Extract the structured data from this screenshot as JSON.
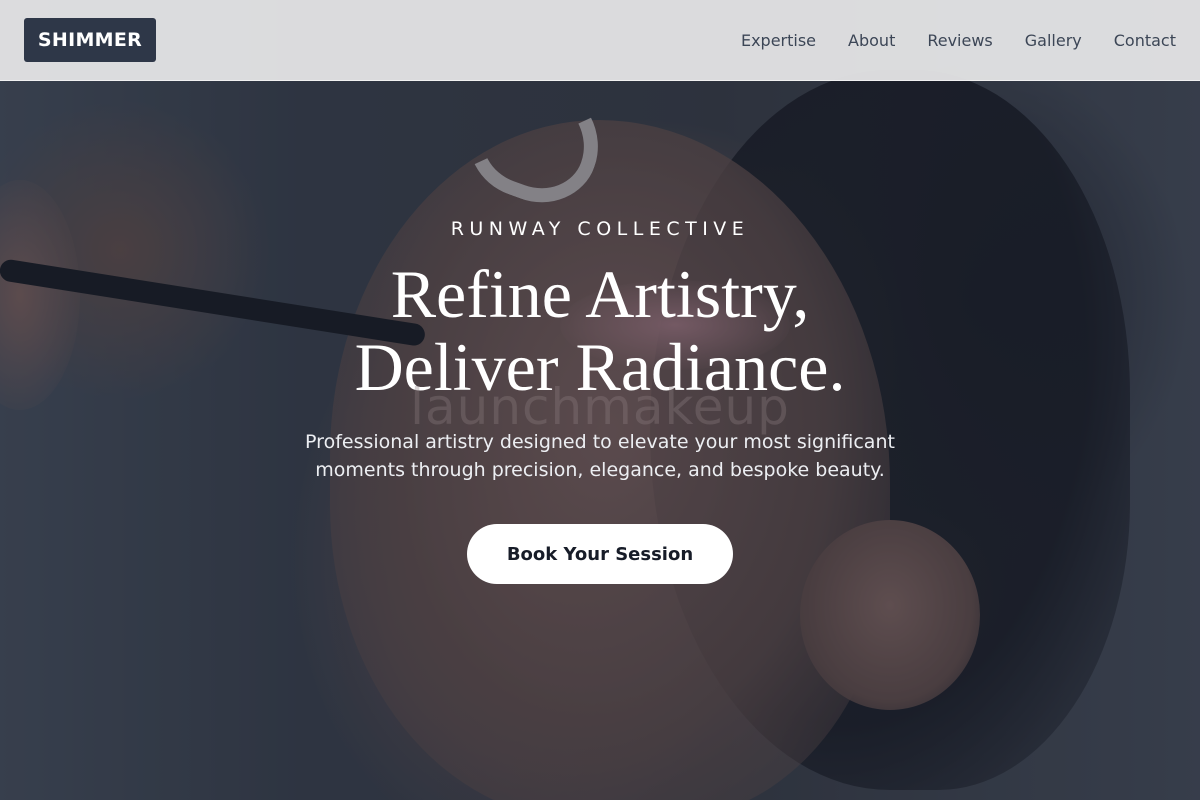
{
  "brand": {
    "logo_text": "SHIMMER",
    "logo_bg": "#2e3748"
  },
  "nav": {
    "items": [
      {
        "label": "Expertise"
      },
      {
        "label": "About"
      },
      {
        "label": "Reviews"
      },
      {
        "label": "Gallery"
      },
      {
        "label": "Contact"
      }
    ]
  },
  "hero": {
    "eyebrow": "RUNWAY COLLECTIVE",
    "headline_line1": "Refine Artistry,",
    "headline_line2": "Deliver Radiance.",
    "watermark": "launchmakeup",
    "subtext": "Professional artistry designed to elevate your most significant moments through precision, elegance, and bespoke beauty.",
    "cta_label": "Book Your Session"
  }
}
